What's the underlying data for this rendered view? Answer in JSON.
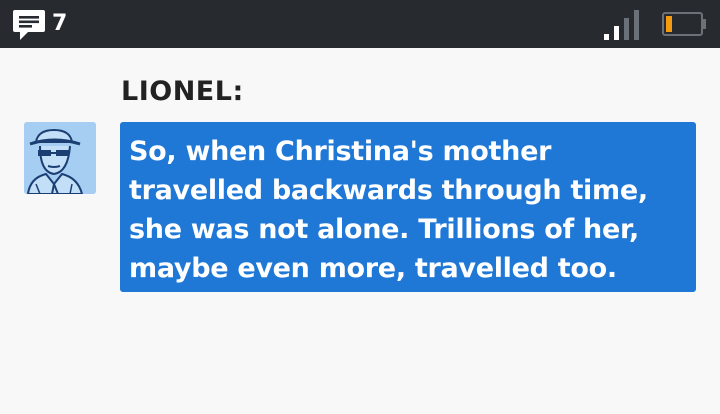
{
  "status_bar": {
    "message_count": "7",
    "icons": {
      "messages": "chat-bubble-icon",
      "signal": "signal-strength-icon",
      "battery": "battery-low-icon"
    },
    "colors": {
      "background": "#272b30",
      "battery_fill": "#f39c12"
    }
  },
  "dialogue": {
    "speaker": "LIONEL:",
    "avatar": "lionel-portrait-icon",
    "text": "So, when Christina's mother travelled backwards through time, she was not alone. Trillions of her, maybe even more, travelled too.",
    "colors": {
      "bubble": "#1f78d6",
      "avatar_bg": "#a6cdf2"
    }
  }
}
